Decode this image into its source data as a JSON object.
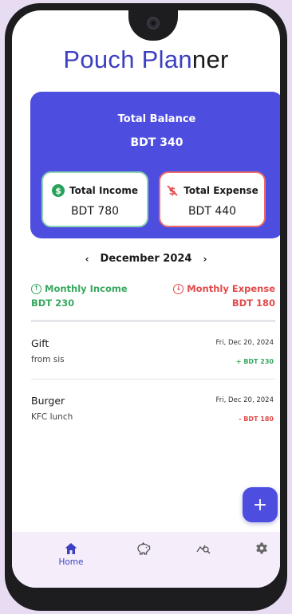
{
  "app": {
    "title_part1": "Pouch Plan",
    "title_part2": "ner"
  },
  "balance": {
    "label": "Total Balance",
    "value": "BDT 340"
  },
  "income_card": {
    "label": "Total Income",
    "value": "BDT 780",
    "icon": "dollar-circle-icon"
  },
  "expense_card": {
    "label": "Total Expense",
    "value": "BDT 440",
    "icon": "money-off-icon"
  },
  "month_nav": {
    "prev": "‹",
    "month": "December 2024",
    "next": "›"
  },
  "monthly": {
    "income_label": "Monthly Income",
    "income_value": "BDT 230",
    "expense_label": "Monthly Expense",
    "expense_value": "BDT 180"
  },
  "transactions": [
    {
      "title": "Gift",
      "note": "from sis",
      "date": "Fri, Dec 20, 2024",
      "amount": "+ BDT 230"
    },
    {
      "title": "Burger",
      "note": "KFC lunch",
      "date": "Fri, Dec 20, 2024",
      "amount": "- BDT 180"
    }
  ],
  "fab_label": "+",
  "nav": {
    "home_label": "Home",
    "items": [
      "home-icon",
      "piggy-bank-icon",
      "analytics-icon",
      "gear-icon"
    ]
  },
  "colors": {
    "accent": "#4d4ee0",
    "income": "#36a85e",
    "expense": "#e24a4a",
    "nav_bg": "#f5eefa"
  }
}
